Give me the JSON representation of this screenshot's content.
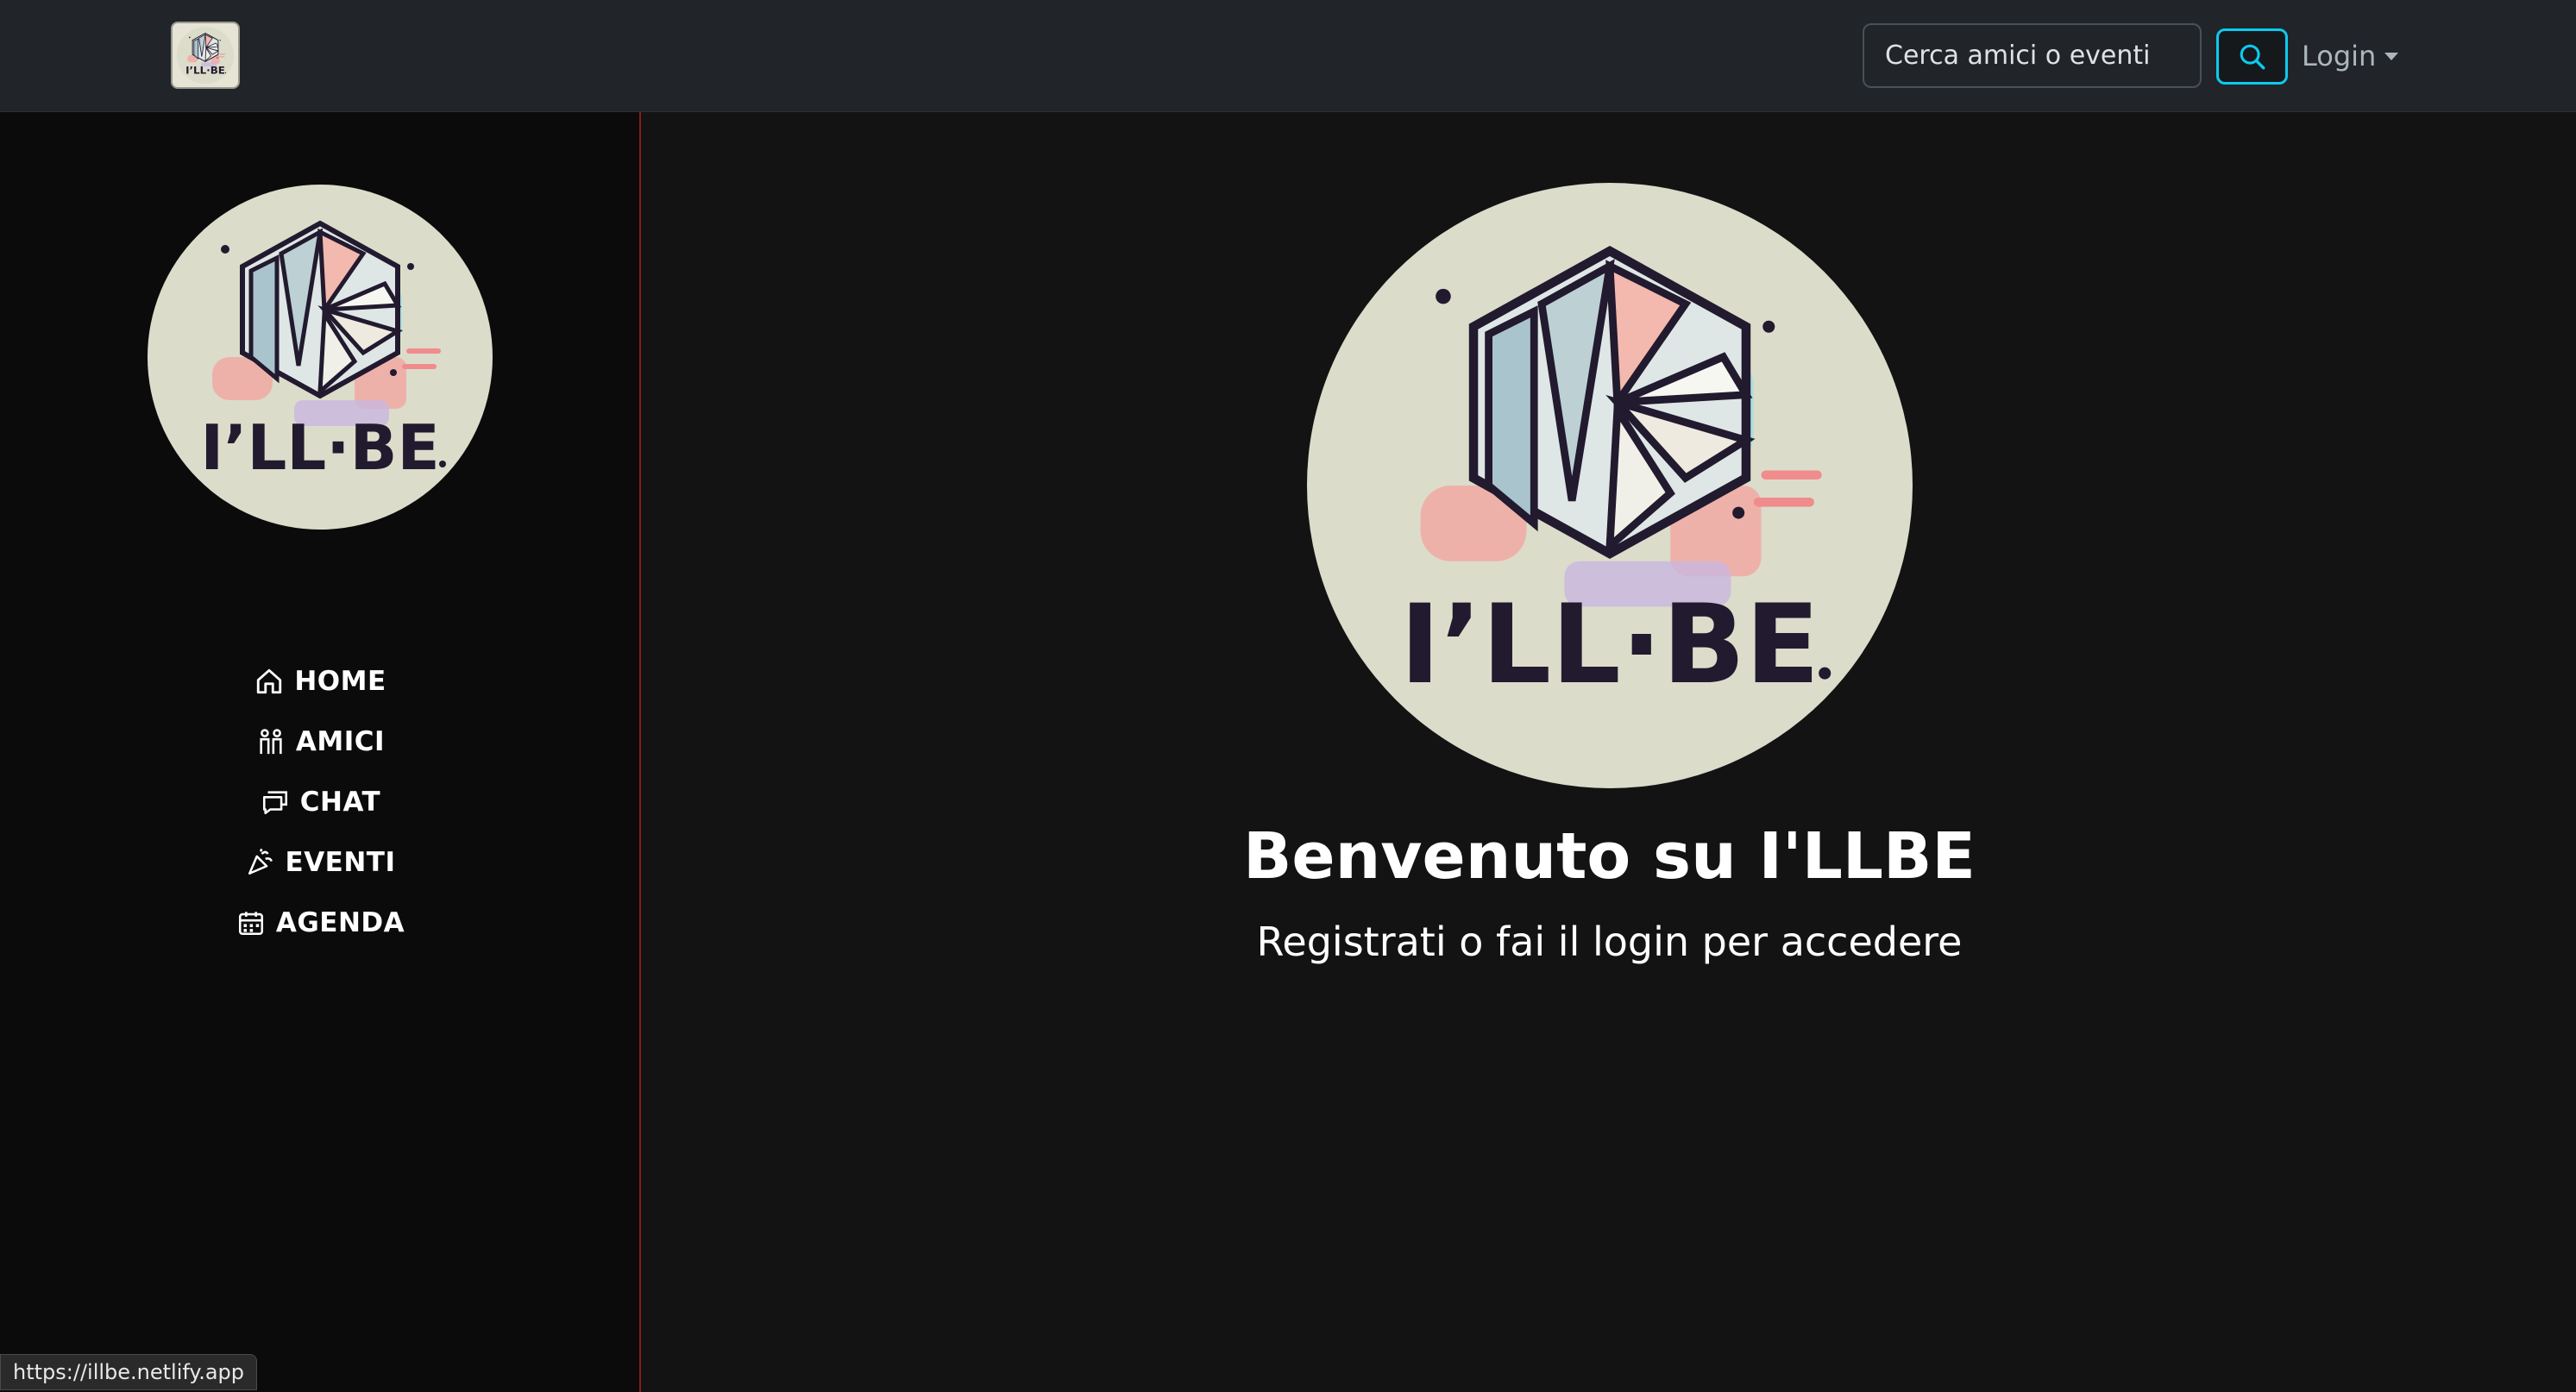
{
  "header": {
    "brand_logo_text": "I'LL BE",
    "search": {
      "placeholder": "Cerca amici o eventi",
      "value": ""
    },
    "search_button_icon": "search-icon",
    "login_label": "Login"
  },
  "sidebar": {
    "logo_text": "I'LL·BE",
    "items": [
      {
        "label": "HOME",
        "icon": "house-icon"
      },
      {
        "label": "AMICI",
        "icon": "people-icon"
      },
      {
        "label": "CHAT",
        "icon": "chat-icon"
      },
      {
        "label": "EVENTI",
        "icon": "party-icon"
      },
      {
        "label": "AGENDA",
        "icon": "calendar-icon"
      }
    ]
  },
  "main": {
    "logo_text": "I'LL·BE",
    "title": "Benvenuto su I'LLBE",
    "subtitle": "Registrati o fai il login per accedere"
  },
  "status_bar": {
    "url": "https://illbe.netlify.app"
  },
  "colors": {
    "topbar_bg": "#212529",
    "sidebar_bg": "#0b0b0b",
    "main_bg": "#131313",
    "search_accent": "#0dcaf0",
    "sidebar_border": "#8b1a1a",
    "logo_circle": "#dcdccb",
    "logo_ink": "#221a2e"
  }
}
